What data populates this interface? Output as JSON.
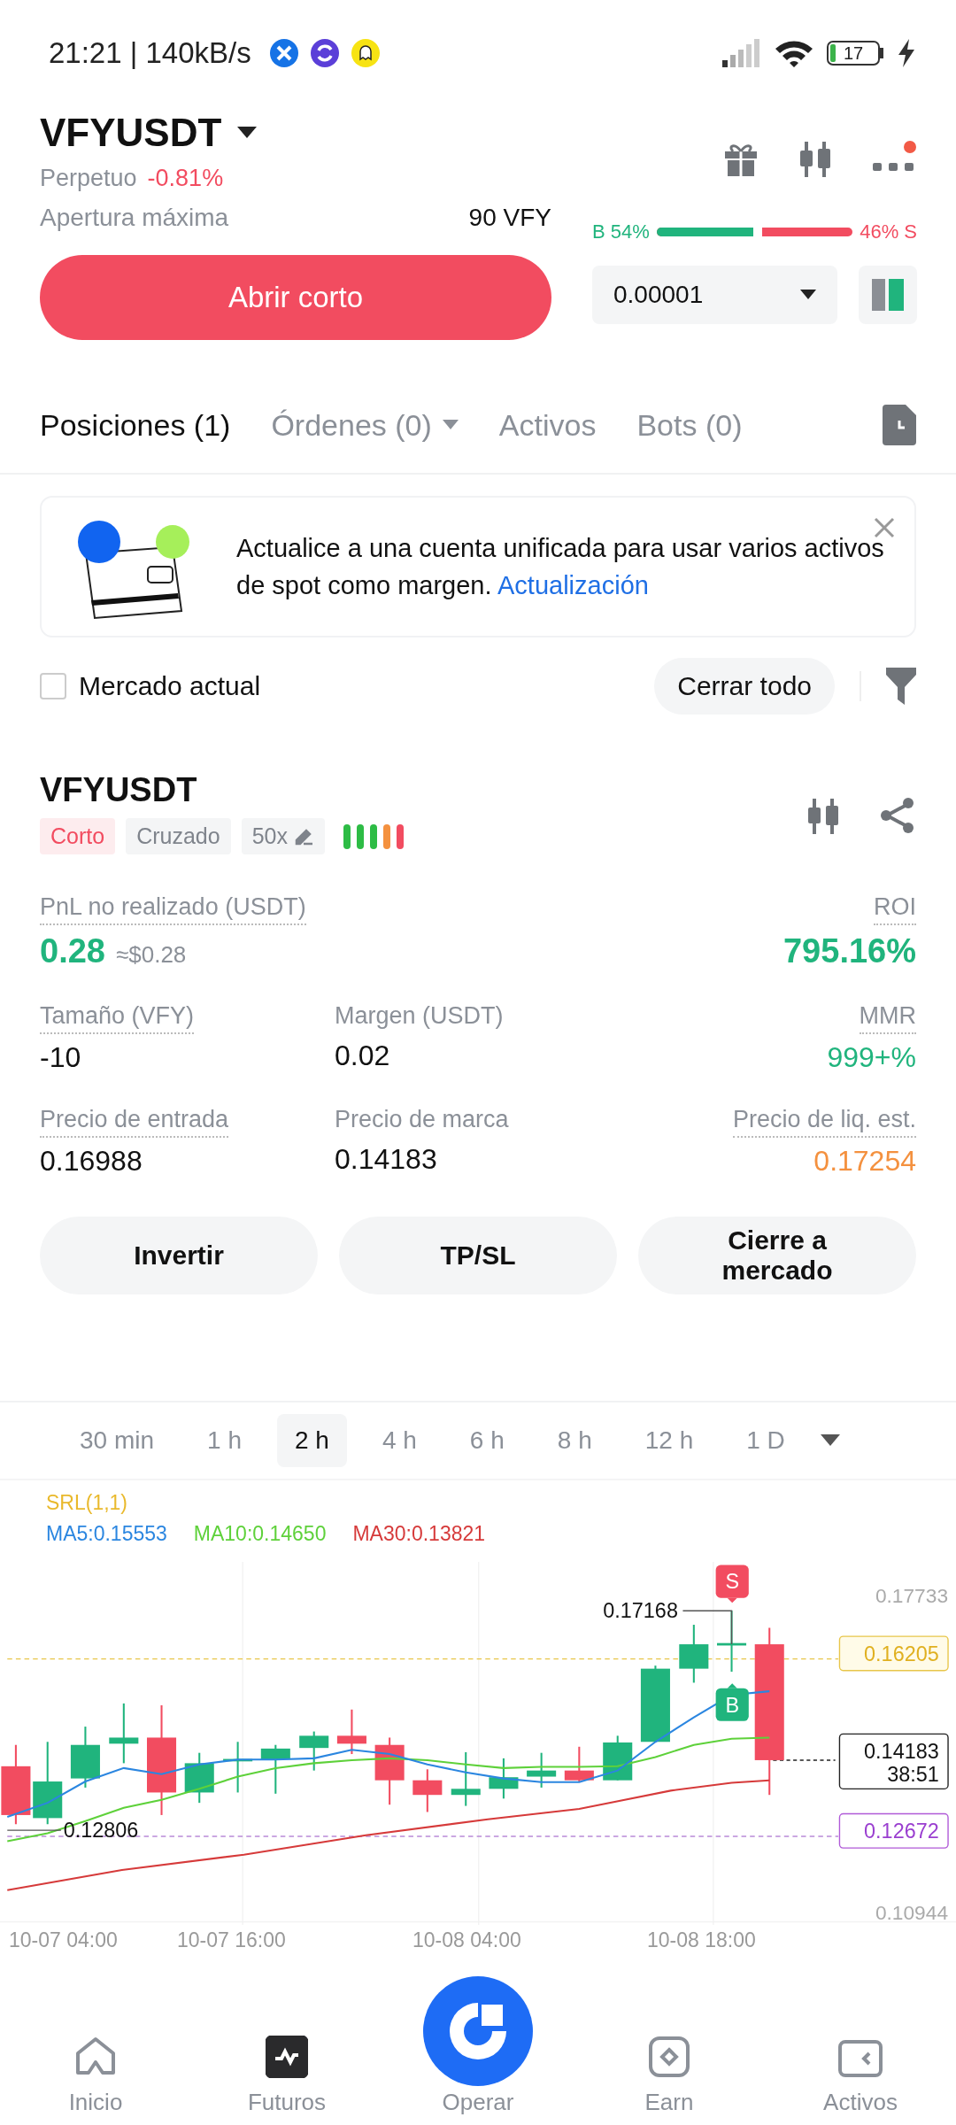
{
  "status_bar": {
    "time_speed": "21:21 | 140kB/s",
    "battery": "17"
  },
  "header": {
    "symbol": "VFYUSDT",
    "type": "Perpetuo",
    "change": "-0.81%",
    "max_open_label": "Apertura máxima",
    "max_open_value": "90 VFY",
    "open_button": "Abrir corto",
    "sentiment": {
      "buy_label": "B 54%",
      "sell_label": "46% S",
      "level": 0.54
    },
    "precision": "0.00001"
  },
  "tabs": [
    {
      "label": "Posiciones (1)",
      "selected": true,
      "dropdown": false
    },
    {
      "label": "Órdenes (0)",
      "selected": false,
      "dropdown": true
    },
    {
      "label": "Activos",
      "selected": false,
      "dropdown": false
    },
    {
      "label": "Bots (0)",
      "selected": false,
      "dropdown": false
    }
  ],
  "banner": {
    "text": "Actualice a una cuenta unificada para usar varios activos de spot como margen.",
    "link": "Actualización"
  },
  "filter": {
    "label": "Mercado actual",
    "checked": false,
    "close_all": "Cerrar todo"
  },
  "position": {
    "symbol": "VFYUSDT",
    "tags": [
      {
        "label": "Corto",
        "kind": "side"
      },
      {
        "label": "Cruzado",
        "kind": "mode"
      },
      {
        "label": "50x",
        "kind": "leverage"
      }
    ],
    "stat_rows": [
      {
        "cells": [
          {
            "label": "PnL no realizado (USDT)",
            "value": "0.28",
            "sub": "≈$0.28",
            "kind": "gain",
            "hint": true
          },
          {
            "label": "ROI",
            "value": "795.16%",
            "kind": "gain",
            "hint": true
          }
        ]
      },
      {
        "cells": [
          {
            "label": "Tamaño (VFY)",
            "value": "-10",
            "kind": "plain",
            "hint": true
          },
          {
            "label": "Margen (USDT)",
            "value": "0.02",
            "kind": "plain",
            "hint": false
          },
          {
            "label": "MMR",
            "value": "999+%",
            "kind": "gain",
            "hint": true
          }
        ]
      },
      {
        "cells": [
          {
            "label": "Precio de entrada",
            "value": "0.16988",
            "kind": "plain",
            "hint": true
          },
          {
            "label": "Precio de marca",
            "value": "0.14183",
            "kind": "plain",
            "hint": false
          },
          {
            "label": "Precio de liq. est.",
            "value": "0.17254",
            "kind": "warning",
            "hint": true
          }
        ]
      }
    ],
    "actions": [
      "Invertir",
      "TP/SL",
      "Cierre a mercado"
    ]
  },
  "chart": {
    "intervals": [
      {
        "label": "30 min",
        "selected": false
      },
      {
        "label": "1 h",
        "selected": false
      },
      {
        "label": "2 h",
        "selected": true
      },
      {
        "label": "4 h",
        "selected": false
      },
      {
        "label": "6 h",
        "selected": false
      },
      {
        "label": "8 h",
        "selected": false
      },
      {
        "label": "12 h",
        "selected": false
      },
      {
        "label": "1 D",
        "selected": false
      }
    ],
    "indicator": "SRL(1,1)",
    "ma": [
      {
        "label": "MA5:0.15553",
        "color": "#2b86e0"
      },
      {
        "label": "MA10:0.14650",
        "color": "#5ed13a"
      },
      {
        "label": "MA30:0.13821",
        "color": "#d63a3a"
      }
    ],
    "price_axis": [
      "0.17733",
      "0.10944"
    ],
    "high_label": "0.17168",
    "low_label": "0.12806",
    "tags": [
      {
        "label": "0.16205",
        "kind": "upper"
      },
      {
        "label": "0.14183",
        "sub": "38:51",
        "kind": "last"
      },
      {
        "label": "0.12672",
        "kind": "lower"
      }
    ],
    "markers": [
      {
        "label": "S",
        "kind": "sell"
      },
      {
        "label": "B",
        "kind": "buy"
      }
    ],
    "dates": [
      "10-07 04:00",
      "10-07 16:00",
      "10-08 04:00",
      "10-08 18:00"
    ]
  },
  "nav": [
    {
      "label": "Inicio",
      "kind": "home",
      "selected": false
    },
    {
      "label": "Futuros",
      "kind": "futures",
      "selected": true
    },
    {
      "label": "Operar",
      "kind": "trade",
      "selected": false
    },
    {
      "label": "Earn",
      "kind": "earn",
      "selected": false
    },
    {
      "label": "Activos",
      "kind": "assets",
      "selected": false
    }
  ]
}
